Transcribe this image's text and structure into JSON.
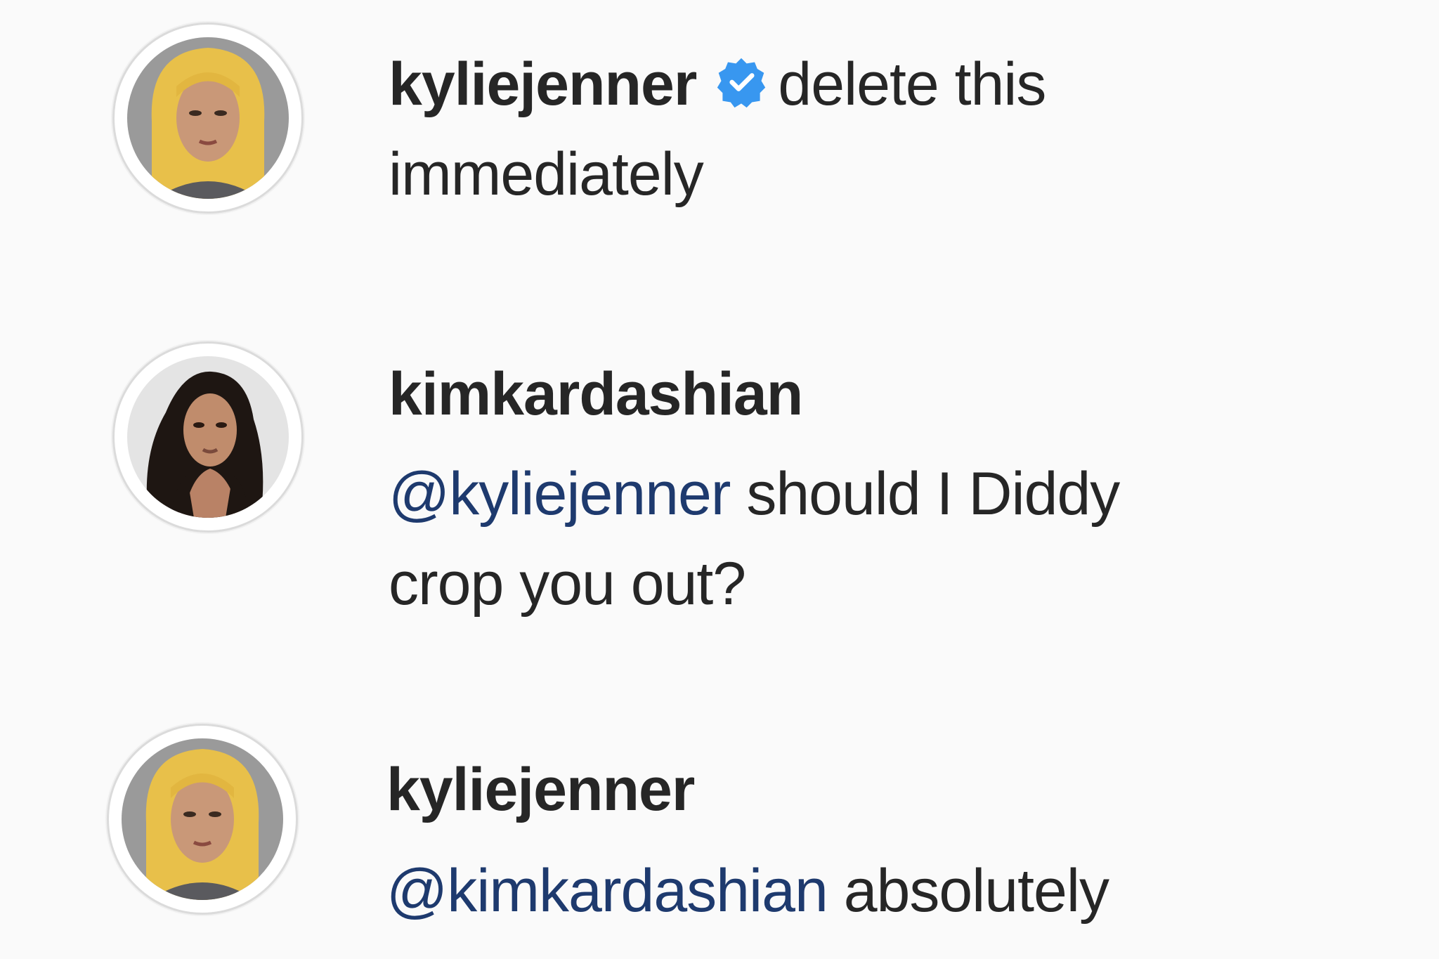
{
  "comments": [
    {
      "username": "kyliejenner",
      "verified": true,
      "mention": "",
      "text_line1": "delete this",
      "text_line2": "immediately",
      "avatar_icon": "kylie-avatar"
    },
    {
      "username": "kimkardashian",
      "verified": false,
      "mention": "@kyliejenner",
      "text_line1": "should I Diddy",
      "text_line2": "crop you out?",
      "avatar_icon": "kim-avatar"
    },
    {
      "username": "kyliejenner",
      "verified": false,
      "mention": "@kimkardashian",
      "text_line1": "absolutely",
      "text_line2": "",
      "avatar_icon": "kylie-avatar"
    }
  ],
  "colors": {
    "background": "#fafafa",
    "username": "#262626",
    "mention": "#1e3a6e",
    "verified_badge": "#3897f0"
  },
  "icons": {
    "verified": "verified-badge-icon"
  }
}
